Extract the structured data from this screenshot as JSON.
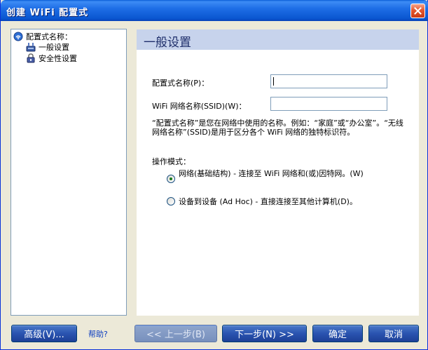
{
  "window": {
    "title": "创建 WiFi 配置式",
    "close_symbol": "×"
  },
  "tree": {
    "root": "配置式名称：",
    "items": [
      {
        "label": "一般设置",
        "icon": "network-plug-icon"
      },
      {
        "label": "安全性设置",
        "icon": "lock-icon"
      }
    ]
  },
  "content": {
    "heading": "一般设置",
    "profile_name_label": "配置式名称(P)：",
    "profile_name_value": "",
    "ssid_label": "WiFi 网络名称(SSID)(W)：",
    "ssid_value": "",
    "description": "“配置式名称”是您在网络中使用的名称。例如：“家庭”或“办公室”。“无线网络名称”(SSID)是用于区分各个 WiFi 网络的独特标识符。",
    "mode_label": "操作模式：",
    "mode_options": [
      {
        "label": "网络(基础结构) - 连接至 WiFi 网络和(或)因特网。(W)",
        "selected": true
      },
      {
        "label": "设备到设备 (Ad Hoc) - 直接连接至其他计算机(D)。",
        "selected": false
      }
    ]
  },
  "buttons": {
    "advanced": "高级(V)...",
    "help": "帮助?",
    "back": "<< 上一步(B)",
    "next": "下一步(N) >>",
    "ok": "确定",
    "cancel": "取消"
  },
  "colors": {
    "title_bar": "#0a56d0",
    "heading_bar": "#c7d3ec",
    "button_blue": "#2a54b0",
    "close_red": "#e4572e"
  }
}
